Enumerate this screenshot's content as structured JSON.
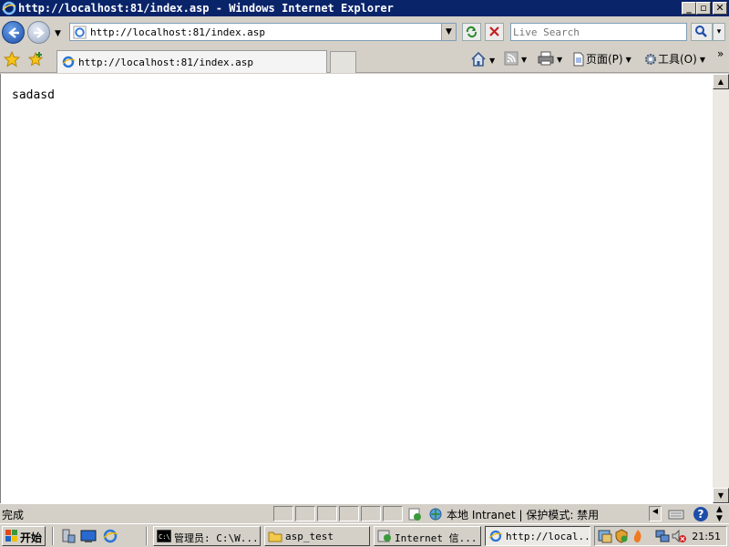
{
  "window": {
    "title": "http://localhost:81/index.asp - Windows Internet Explorer",
    "minimize_glyph": "_",
    "maximize_glyph": "▫",
    "close_glyph": "✕"
  },
  "address": {
    "url": "http://localhost:81/index.asp",
    "search_placeholder": "Live Search"
  },
  "tabs": [
    {
      "label": "http://localhost:81/index.asp"
    }
  ],
  "commandbar": {
    "page_label": "页面(P)",
    "tools_label": "工具(O)",
    "more_glyph": "»"
  },
  "page": {
    "body_text": "sadasd"
  },
  "statusbar": {
    "status": "完成",
    "zone": "本地 Intranet | 保护模式: 禁用"
  },
  "taskbar": {
    "start_label": "开始",
    "tasks": [
      {
        "label": "管理员: C:\\W...",
        "icon": "cmd-icon"
      },
      {
        "label": "asp_test",
        "icon": "folder-icon"
      },
      {
        "label": "Internet 信...",
        "icon": "iis-icon"
      },
      {
        "label": "http://local...",
        "icon": "ie-icon",
        "active": true
      }
    ],
    "clock": "21:51"
  },
  "colors": {
    "titlebar": "#0a246a",
    "chrome": "#d4d0c8",
    "content_bg": "#ffffff"
  }
}
